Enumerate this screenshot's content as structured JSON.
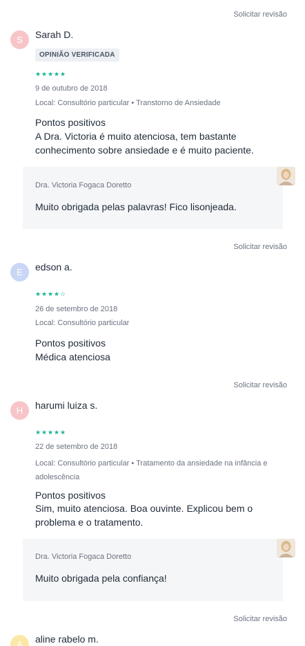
{
  "request_label": "Solicitar revisão",
  "verified_label": "OPINIÃO VERIFICADA",
  "positives_label": "Pontos positivos",
  "colors": {
    "star": "#1ab394",
    "avatar_pink": "#f7c5c8",
    "avatar_blue": "#c9d6f5",
    "avatar_yellow": "#fbe8a6"
  },
  "reviews": [
    {
      "initial": "S",
      "author": "Sarah D.",
      "verified": true,
      "rating": 5,
      "date": "9 de outubro de 2018",
      "location": "Local: Consultório particular • Transtorno de Ansiedade",
      "positives": "A Dra. Victoria é muito atenciosa, tem bastante conhecimento sobre ansiedade e é muito paciente.",
      "reply": {
        "doctor": "Dra. Victoria Fogaca Doretto",
        "text": "Muito obrigada pelas palavras! Fico lisonjeada."
      }
    },
    {
      "initial": "E",
      "author": "edson a.",
      "verified": false,
      "rating": 4,
      "date": "26 de setembro de 2018",
      "location": "Local: Consultório particular",
      "positives": "Médica atenciosa"
    },
    {
      "initial": "H",
      "author": "harumi luiza s.",
      "verified": false,
      "rating": 5,
      "date": "22 de setembro de 2018",
      "location": "Local: Consultório particular • Tratamento da ansiedade na infância e adolescência",
      "positives": "Sim, muito atenciosa. Boa ouvinte. Explicou bem o problema e o tratamento.",
      "reply": {
        "doctor": "Dra. Victoria Fogaca Doretto",
        "text": "Muito obrigada pela confiança!"
      }
    },
    {
      "initial": "A",
      "author": "aline rabelo m."
    }
  ]
}
